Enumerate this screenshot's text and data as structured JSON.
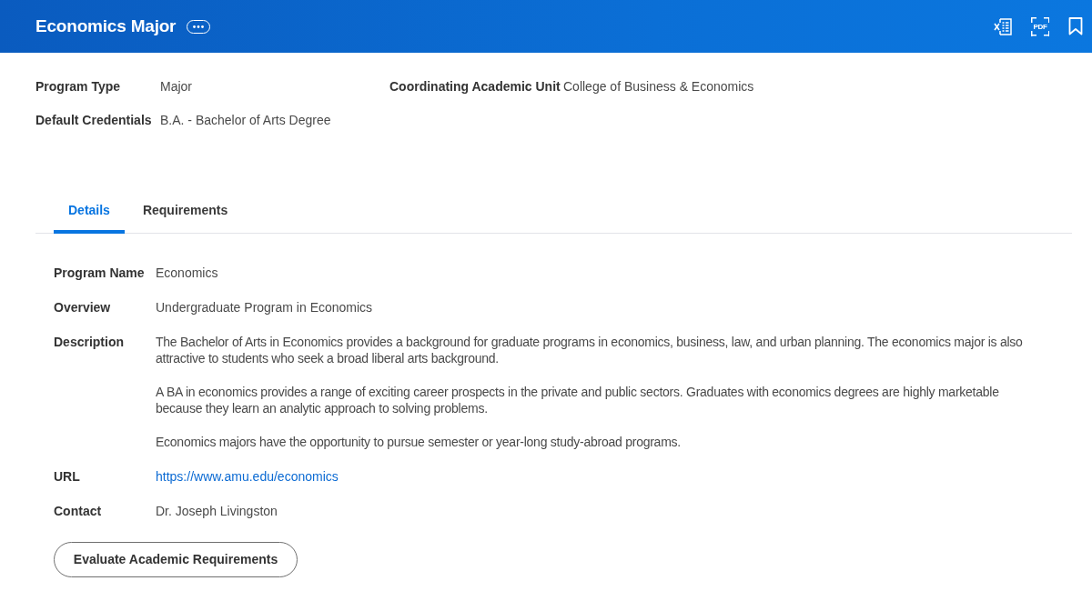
{
  "header": {
    "title": "Economics Major",
    "actions": [
      {
        "kind": "spreadsheet"
      },
      {
        "kind": "pdf",
        "label": "PDF"
      },
      {
        "kind": "bookmark"
      }
    ]
  },
  "summary_fields": [
    {
      "label": "Program Type",
      "value": "Major"
    },
    {
      "label": "Coordinating Academic Unit",
      "value": "College of Business & Economics"
    },
    {
      "label": "Default Credentials",
      "value": "B.A. - Bachelor of Arts Degree"
    }
  ],
  "tabs": [
    {
      "label": "Details",
      "selected": true
    },
    {
      "label": "Requirements",
      "selected": false
    }
  ],
  "details": [
    {
      "label": "Program Name",
      "kind": "text",
      "value": "Economics"
    },
    {
      "label": "Overview",
      "kind": "text",
      "value": "Undergraduate Program in Economics"
    },
    {
      "label": "Description",
      "kind": "paragraphs",
      "paragraphs": [
        "The Bachelor of Arts in Economics provides a background for graduate programs in economics, business, law, and urban planning. The economics major is also attractive to students who seek a broad liberal arts background.",
        "A BA in economics provides a range of exciting career prospects in the private and public sectors. Graduates with economics degrees are highly marketable because they learn an analytic approach to solving problems.",
        "Economics majors have the opportunity to pursue semester or year-long study-abroad programs."
      ]
    },
    {
      "label": "URL",
      "kind": "link",
      "value": "https://www.amu.edu/economics"
    },
    {
      "label": "Contact",
      "kind": "text",
      "value": "Dr. Joseph Livingston"
    }
  ],
  "button": {
    "label": "Evaluate Academic Requirements"
  }
}
